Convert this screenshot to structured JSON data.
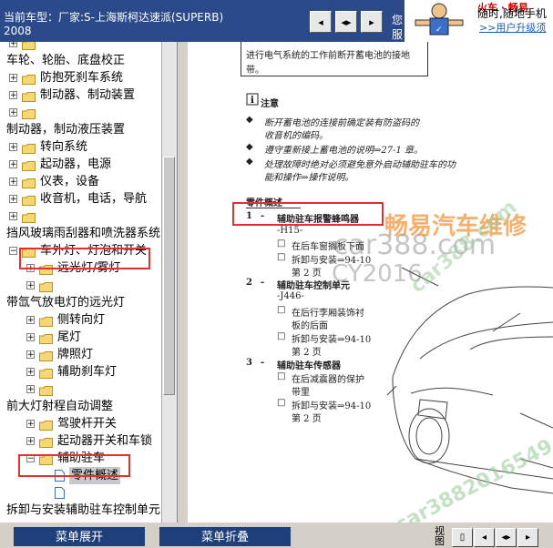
{
  "header": {
    "title": "当前车型：厂家:S-上海斯柯达速派(SUPERB)",
    "year": "2008",
    "extra_text": "您服",
    "toolbar_buttons": [
      {
        "icon": "prev-icon",
        "glyph": "◂"
      },
      {
        "icon": "dual-arrow-icon",
        "glyph": "◂▸"
      },
      {
        "icon": "next-icon",
        "glyph": "▸"
      }
    ]
  },
  "ad": {
    "top": "火车 · 畅易",
    "line1": "随时,随地手机",
    "line2": ">>用户升级须"
  },
  "tree": {
    "items": [
      {
        "label": "",
        "expander": "+",
        "folder": true,
        "indent": 1
      },
      {
        "label": "车轮、轮胎、底盘校正",
        "expander": "",
        "folder": false,
        "indent": 0
      },
      {
        "label": "防抱死刹车系统",
        "expander": "+",
        "folder": true,
        "indent": 1
      },
      {
        "label": "制动器、制动装置",
        "expander": "+",
        "folder": true,
        "indent": 1
      },
      {
        "label": "",
        "expander": "+",
        "folder": true,
        "indent": 1
      },
      {
        "label": "制动器，制动液压装置",
        "expander": "",
        "folder": false,
        "indent": 0
      },
      {
        "label": "转向系统",
        "expander": "+",
        "folder": true,
        "indent": 1
      },
      {
        "label": "起动器，电源",
        "expander": "+",
        "folder": true,
        "indent": 1
      },
      {
        "label": "仪表，设备",
        "expander": "+",
        "folder": true,
        "indent": 1
      },
      {
        "label": "收音机，电话，导航",
        "expander": "+",
        "folder": true,
        "indent": 1
      },
      {
        "label": "",
        "expander": "+",
        "folder": true,
        "indent": 1
      },
      {
        "label": "挡风玻璃雨刮器和喷洗器系统",
        "expander": "",
        "folder": false,
        "indent": 0
      },
      {
        "label": "车外灯、灯泡和开关",
        "expander": "−",
        "folder": true,
        "indent": 1
      },
      {
        "label": "远光灯/雾灯",
        "expander": "+",
        "folder": true,
        "indent": 2
      },
      {
        "label": "",
        "expander": "+",
        "folder": true,
        "indent": 2
      },
      {
        "label": "带氙气放电灯的远光灯",
        "expander": "",
        "folder": false,
        "indent": 0
      },
      {
        "label": "侧转向灯",
        "expander": "+",
        "folder": true,
        "indent": 2
      },
      {
        "label": "尾灯",
        "expander": "+",
        "folder": true,
        "indent": 2
      },
      {
        "label": "牌照灯",
        "expander": "+",
        "folder": true,
        "indent": 2
      },
      {
        "label": "辅助刹车灯",
        "expander": "+",
        "folder": true,
        "indent": 2
      },
      {
        "label": "",
        "expander": "+",
        "folder": true,
        "indent": 2
      },
      {
        "label": "前大灯射程自动调整",
        "expander": "",
        "folder": false,
        "indent": 0
      },
      {
        "label": "驾驶杆开关",
        "expander": "+",
        "folder": true,
        "indent": 2
      },
      {
        "label": "起动器开关和车锁",
        "expander": "+",
        "folder": true,
        "indent": 2
      },
      {
        "label": "辅助驻车",
        "expander": "−",
        "folder": true,
        "indent": 2
      },
      {
        "label": "零件概述",
        "expander": "",
        "folder": false,
        "indent": 3,
        "page": true,
        "selected": true
      },
      {
        "label": "",
        "expander": "",
        "folder": false,
        "indent": 3,
        "page": true
      },
      {
        "label": "拆卸与安装辅助驻车控制单元",
        "expander": "",
        "folder": false,
        "indent": 0
      }
    ]
  },
  "doc": {
    "top_note_l1": "进行电气系统的工作前断开蓄电池的接地",
    "top_note_l2": "带。",
    "note_title": "注意",
    "bullets": [
      [
        "断开蓄电池的连接前确定装有防盗码的",
        "收音机的编码。"
      ],
      [
        "遵守重新接上蓄电池的说明⇒27-1 章。"
      ],
      [
        "处理故障时绝对必须避免意外启动辅助驻车的功",
        "能和操作⇒操作说明。"
      ]
    ],
    "parts_title": "零件概述",
    "parts": [
      {
        "num": "1",
        "name": "辅助驻车报警蜂鸣器",
        "sub": [
          "-H15-",
          "在后车窗搁板下面",
          "拆卸与安装⇒94-10",
          "第 2 页"
        ]
      },
      {
        "num": "2",
        "name": "辅助驻车控制单元",
        "sub": [
          "-J446-",
          "在后行李厢装饰衬",
          "板的后面",
          "拆卸与安装⇒94-10",
          "第 2 页"
        ]
      },
      {
        "num": "3",
        "name": "辅助驻车传感器",
        "sub": [
          "在后减震器的保护",
          "带里",
          "拆卸与安装⇒94-10",
          "第 2 页"
        ]
      }
    ]
  },
  "watermarks": {
    "main": "car388.com",
    "brand": "畅易汽车维修",
    "code": "CY2016",
    "diag1": "car388.com",
    "diag2": "car3882016549"
  },
  "bottom": {
    "expand_label": "菜单展开",
    "collapse_label": "菜单折叠",
    "view_label": "视图"
  }
}
